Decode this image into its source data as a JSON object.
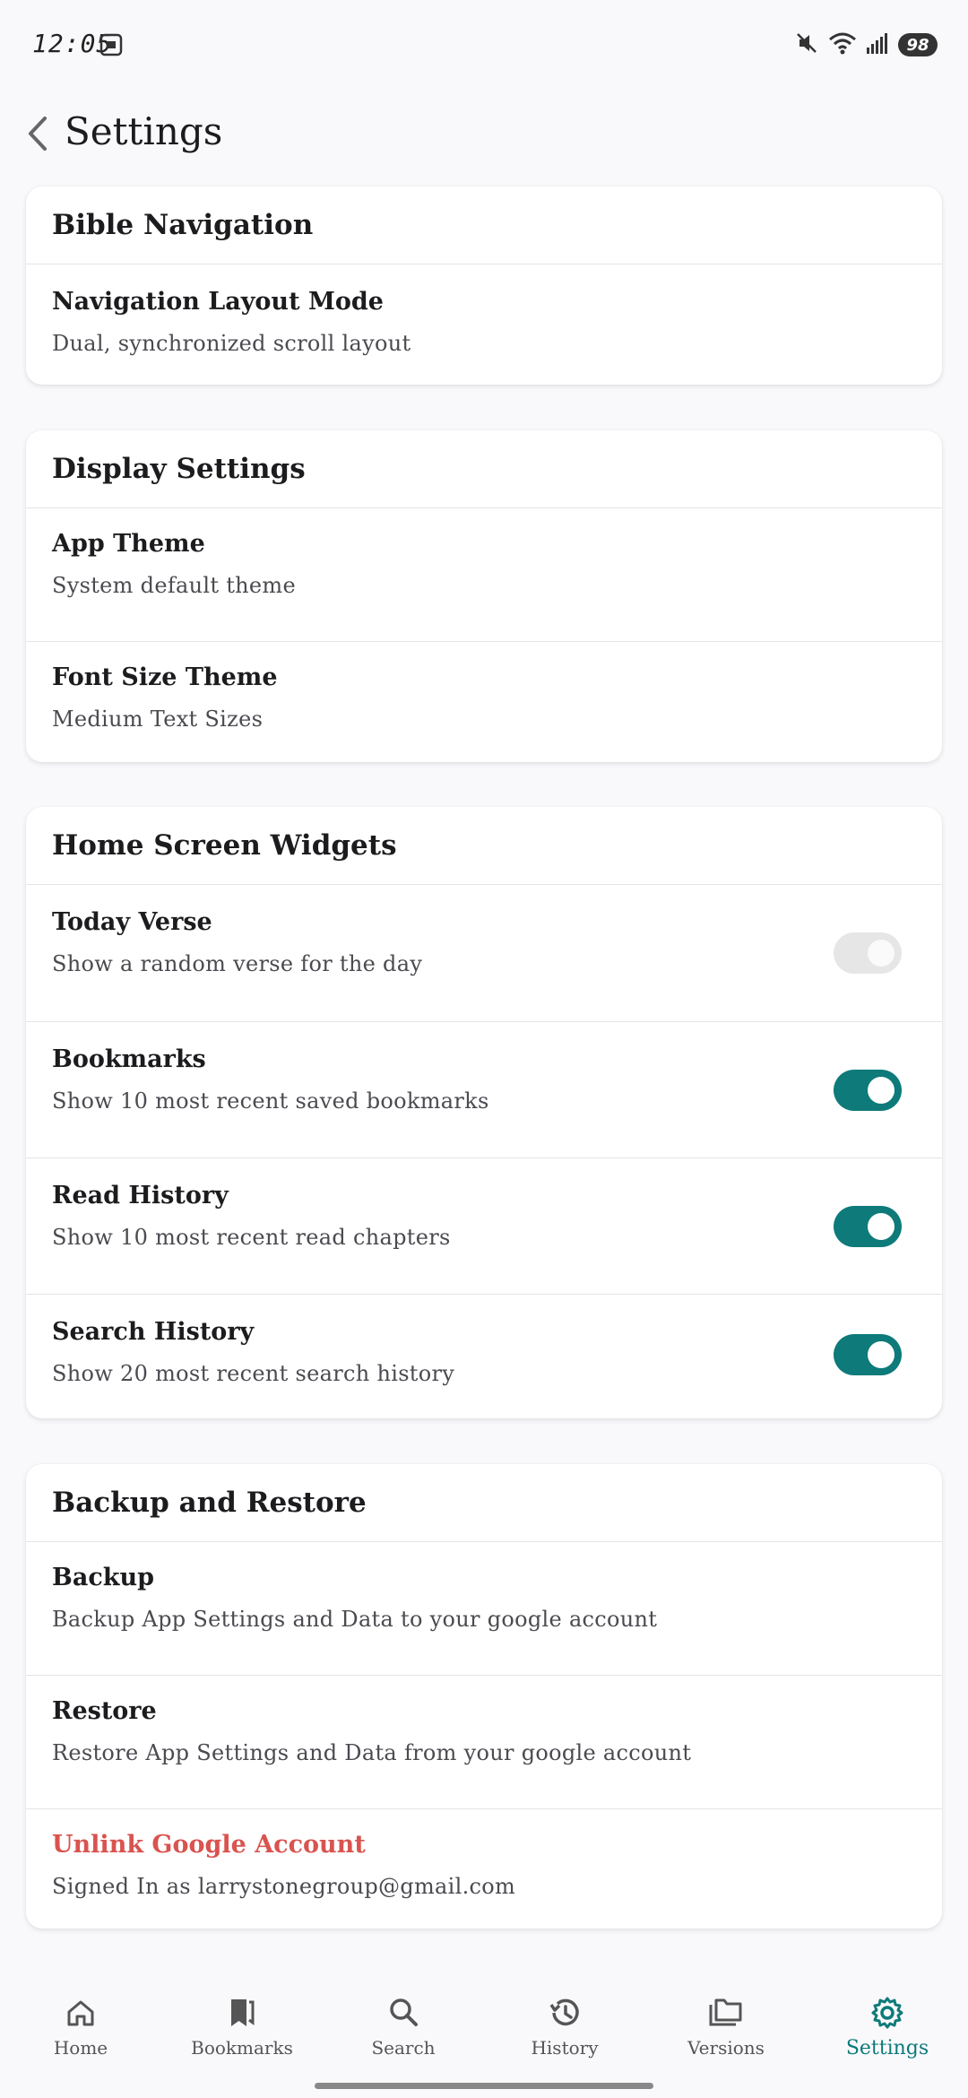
{
  "status": {
    "time": "12:05",
    "battery": "98"
  },
  "app_bar": {
    "title": "Settings"
  },
  "sections": [
    {
      "title": "Bible Navigation",
      "items": [
        {
          "title": "Navigation Layout Mode",
          "subtitle": "Dual, synchronized scroll layout"
        }
      ]
    },
    {
      "title": "Display Settings",
      "items": [
        {
          "title": "App Theme",
          "subtitle": "System default theme"
        },
        {
          "title": "Font Size Theme",
          "subtitle": "Medium Text Sizes"
        }
      ]
    },
    {
      "title": "Home Screen Widgets",
      "items": [
        {
          "title": "Today Verse",
          "subtitle": "Show a random verse for the day",
          "toggle": "disabled"
        },
        {
          "title": "Bookmarks",
          "subtitle": "Show 10 most recent saved bookmarks",
          "toggle": "on"
        },
        {
          "title": "Read History",
          "subtitle": "Show 10 most recent read chapters",
          "toggle": "on"
        },
        {
          "title": "Search History",
          "subtitle": "Show 20 most recent search history",
          "toggle": "on"
        }
      ]
    },
    {
      "title": "Backup and Restore",
      "items": [
        {
          "title": "Backup",
          "subtitle": "Backup App Settings and Data to your google account"
        },
        {
          "title": "Restore",
          "subtitle": "Restore App Settings and Data from your google account"
        },
        {
          "title": "Unlink Google Account",
          "subtitle": "Signed In as larrystonegroup@gmail.com"
        }
      ]
    }
  ],
  "bottom_nav": [
    {
      "label": "Home",
      "icon": "home-icon"
    },
    {
      "label": "Bookmarks",
      "icon": "bookmark-icon"
    },
    {
      "label": "Search",
      "icon": "search-icon"
    },
    {
      "label": "History",
      "icon": "history-icon"
    },
    {
      "label": "Versions",
      "icon": "folders-icon"
    },
    {
      "label": "Settings",
      "icon": "gear-icon",
      "active": true
    }
  ],
  "colors": {
    "accent": "#0e7a7a",
    "danger": "#d9534f",
    "background": "#f9f9fc"
  }
}
